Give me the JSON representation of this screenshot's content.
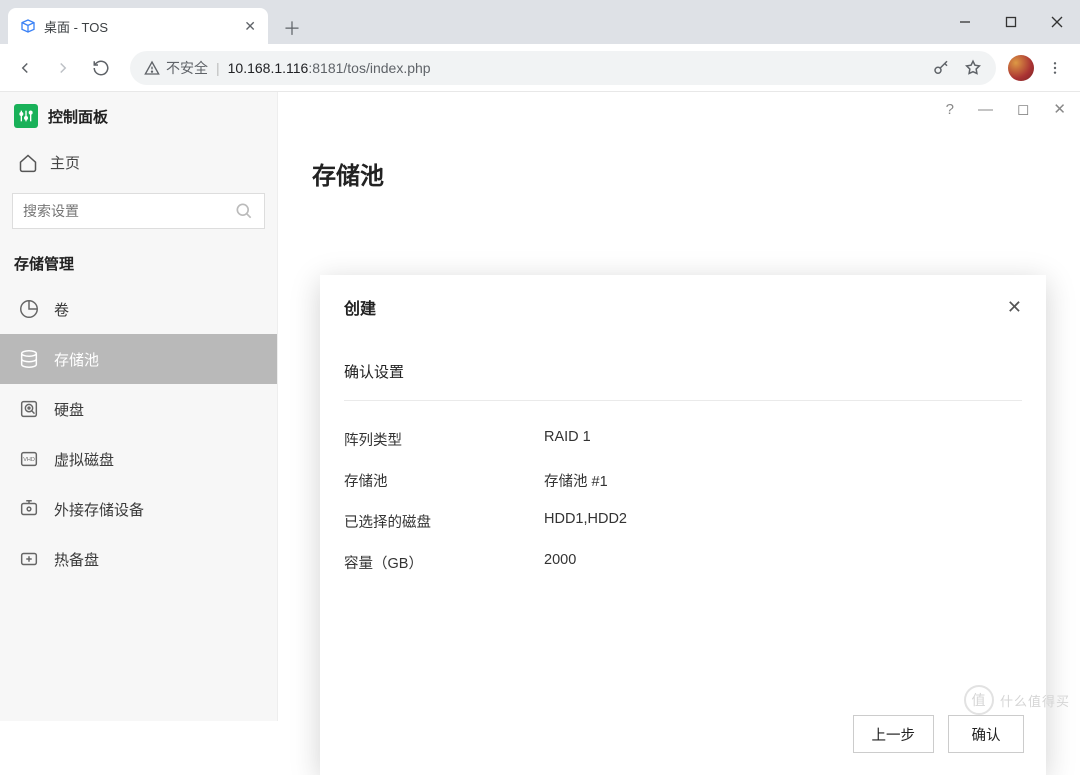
{
  "browser": {
    "tab_title": "桌面 - TOS",
    "security_label": "不安全",
    "url_host": "10.168.1.116",
    "url_port": ":8181",
    "url_path": "/tos/index.php"
  },
  "panel": {
    "title": "控制面板",
    "home": "主页",
    "search_placeholder": "搜索设置",
    "section_storage": "存储管理",
    "items": {
      "volume": "卷",
      "pool": "存储池",
      "disk": "硬盘",
      "vdisk": "虚拟磁盘",
      "external": "外接存储设备",
      "hotspare": "热备盘"
    }
  },
  "page": {
    "title": "存储池"
  },
  "dialog": {
    "title": "创建",
    "section": "确认设置",
    "rows": {
      "array_type_label": "阵列类型",
      "array_type_value": "RAID 1",
      "pool_label": "存储池",
      "pool_value": "存储池 #1",
      "disks_label": "已选择的磁盘",
      "disks_value": "HDD1,HDD2",
      "capacity_label": "容量（GB）",
      "capacity_value": "2000"
    },
    "prev": "上一步",
    "confirm": "确认"
  },
  "watermark": {
    "char": "值",
    "text": "什么值得买"
  }
}
